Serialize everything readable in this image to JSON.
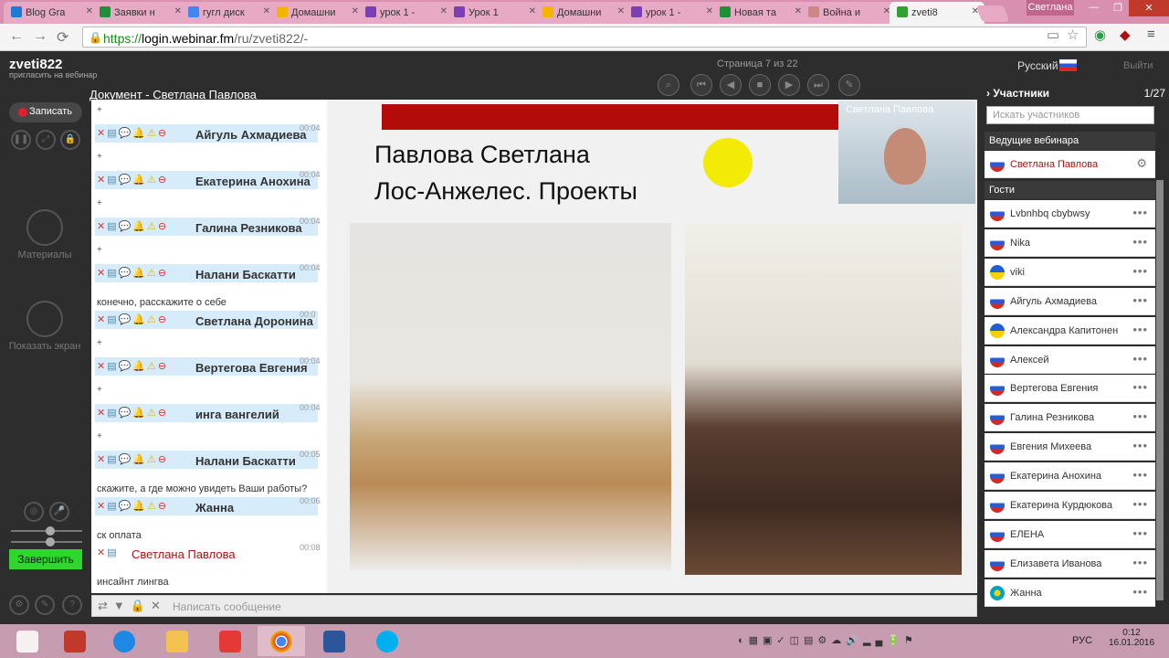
{
  "browser": {
    "tabs": [
      {
        "label": "Blog Gra",
        "color": "#1c7bd4",
        "active": false
      },
      {
        "label": "Заявки н",
        "color": "#1f8f3a",
        "active": false
      },
      {
        "label": "гугл диск",
        "color": "#4285f4",
        "active": false
      },
      {
        "label": "Домашни",
        "color": "#f4b400",
        "active": false
      },
      {
        "label": "урок 1 -",
        "color": "#7b3fb3",
        "active": false
      },
      {
        "label": "Урок 1",
        "color": "#7b3fb3",
        "active": false
      },
      {
        "label": "Домашни",
        "color": "#f4b400",
        "active": false
      },
      {
        "label": "урок 1 -",
        "color": "#7b3fb3",
        "active": false
      },
      {
        "label": "Новая та",
        "color": "#1f8f3a",
        "active": false
      },
      {
        "label": "Война и",
        "color": "#c88",
        "active": false
      },
      {
        "label": "zveti8",
        "color": "#2fa32f",
        "active": true
      }
    ],
    "user_badge": "Светлана",
    "url_prefix": "https://",
    "url_host": "login.webinar.fm",
    "url_path": "/ru/zveti822/-"
  },
  "app": {
    "name": "zveti822",
    "invite": "пригласить на вебинар",
    "page_indicator": "Страница 7 из 22",
    "language": "Русский",
    "exit": "Выйти",
    "record": "Записать",
    "materials": "Материалы",
    "show_screen": "Показать экран",
    "finish": "Завершить",
    "doc_title": "Документ - Светлана Павлова",
    "composer_placeholder": "Написать сообщение"
  },
  "chat": [
    {
      "text": "+",
      "name": "Айгуль Ахмадиева",
      "time": "00:04"
    },
    {
      "text": "+",
      "name": "Екатерина Анохина",
      "time": "00:04"
    },
    {
      "text": "+",
      "name": "Галина Резникова",
      "time": "00:04"
    },
    {
      "text": "+",
      "name": "Налани Баскатти",
      "time": "00:04"
    },
    {
      "text": "конечно, расскажите о себе",
      "name": "Светлана Доронина",
      "time": "00:0"
    },
    {
      "text": "+",
      "name": "Вертегова Евгения",
      "time": "00:04"
    },
    {
      "text": "+",
      "name": "инга вангелий",
      "time": "00:04"
    },
    {
      "text": "+",
      "name": "Налани Баскатти",
      "time": "00:05"
    },
    {
      "text": "скажите, а где можно увидеть Ваши работы?",
      "name": "Жанна",
      "time": "00:06"
    },
    {
      "text": "ск оплата",
      "name": "Светлана Павлова",
      "time": "00:08",
      "host": true
    },
    {
      "text": "инсайнт лингва",
      "name": "",
      "time": ""
    }
  ],
  "slide": {
    "title_line1": "Павлова Светлана",
    "title_line2": "Лос-Анжелес. Проекты",
    "cam_label": "Светлана Павлова"
  },
  "participants": {
    "title": "Участники",
    "count": "1/27",
    "search_placeholder": "Искать участников",
    "hosts_label": "Ведущие вебинара",
    "host": "Светлана Павлова",
    "guests_label": "Гости",
    "guests": [
      {
        "name": "Lvbnhbq cbybwsy",
        "flag": "ru"
      },
      {
        "name": "Nika",
        "flag": "ru"
      },
      {
        "name": "viki",
        "flag": "ua"
      },
      {
        "name": "Айгуль Ахмадиева",
        "flag": "ru"
      },
      {
        "name": "Александра Капитонен",
        "flag": "ua"
      },
      {
        "name": "Алексей",
        "flag": "ru"
      },
      {
        "name": "Вертегова Евгения",
        "flag": "ru"
      },
      {
        "name": "Галина Резникова",
        "flag": "ru"
      },
      {
        "name": "Евгения Михеева",
        "flag": "ru"
      },
      {
        "name": "Екатерина Анохина",
        "flag": "ru"
      },
      {
        "name": "Екатерина Курдюкова",
        "flag": "ru"
      },
      {
        "name": "ЕЛЕНА",
        "flag": "ru"
      },
      {
        "name": "Елизавета Иванова",
        "flag": "ru"
      },
      {
        "name": "Жанна",
        "flag": "kz"
      }
    ]
  },
  "taskbar": {
    "lang": "РУС",
    "time": "0:12",
    "date": "16.01.2016"
  }
}
